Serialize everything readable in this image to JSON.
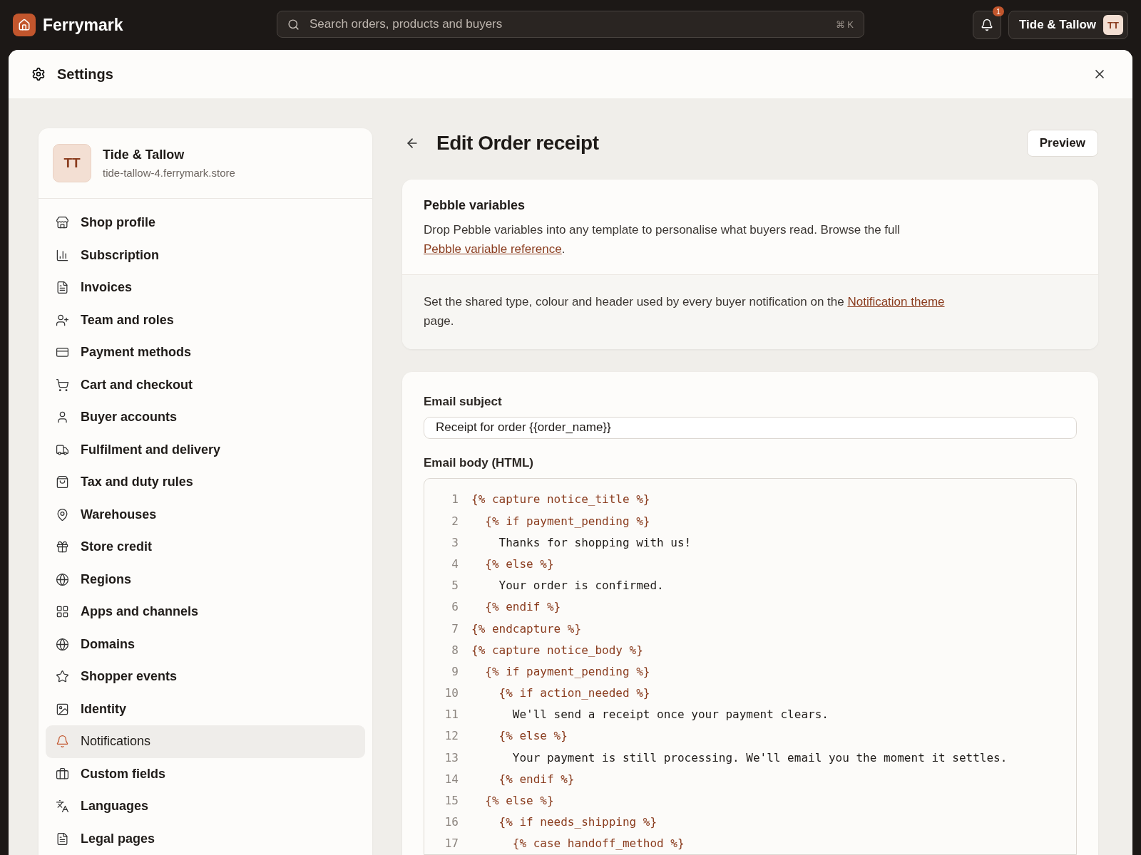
{
  "app": {
    "name": "Ferrymark"
  },
  "search": {
    "placeholder": "Search orders, products and buyers",
    "shortcut": "⌘ K"
  },
  "notifications": {
    "count": "1"
  },
  "account": {
    "name": "Tide & Tallow",
    "initials": "TT"
  },
  "dialog": {
    "title": "Settings"
  },
  "shop": {
    "initials": "TT",
    "name": "Tide & Tallow",
    "domain": "tide-tallow-4.ferrymark.store"
  },
  "sidebar": {
    "items": [
      {
        "label": "Shop profile",
        "selected": false
      },
      {
        "label": "Subscription",
        "selected": false
      },
      {
        "label": "Invoices",
        "selected": false
      },
      {
        "label": "Team and roles",
        "selected": false
      },
      {
        "label": "Payment methods",
        "selected": false
      },
      {
        "label": "Cart and checkout",
        "selected": false
      },
      {
        "label": "Buyer accounts",
        "selected": false
      },
      {
        "label": "Fulfilment and delivery",
        "selected": false
      },
      {
        "label": "Tax and duty rules",
        "selected": false
      },
      {
        "label": "Warehouses",
        "selected": false
      },
      {
        "label": "Store credit",
        "selected": false
      },
      {
        "label": "Regions",
        "selected": false
      },
      {
        "label": "Apps and channels",
        "selected": false
      },
      {
        "label": "Domains",
        "selected": false
      },
      {
        "label": "Shopper events",
        "selected": false
      },
      {
        "label": "Identity",
        "selected": false
      },
      {
        "label": "Notifications",
        "selected": true
      },
      {
        "label": "Custom fields",
        "selected": false
      },
      {
        "label": "Languages",
        "selected": false
      },
      {
        "label": "Legal pages",
        "selected": false
      }
    ]
  },
  "editor": {
    "title": "Edit Order receipt",
    "preview_button": "Preview",
    "info": {
      "title": "Pebble variables",
      "text": "Drop Pebble variables into any template to personalise what buyers read. Browse the full ",
      "link": "Pebble variable reference",
      "text_end": ".",
      "theme_text": "Set the shared type, colour and header used by every buyer notification on the ",
      "theme_link": "Notification theme",
      "theme_text_end": " page."
    },
    "subject": {
      "label": "Email subject",
      "value": "Receipt for order {{order_name}}"
    },
    "body": {
      "label": "Email body (HTML)",
      "lines": [
        {
          "number": "1",
          "kind": "tag",
          "text": "{% capture notice_title %}"
        },
        {
          "number": "2",
          "kind": "tag",
          "text": "  {% if payment_pending %}"
        },
        {
          "number": "3",
          "kind": "text",
          "text": "    Thanks for shopping with us!"
        },
        {
          "number": "4",
          "kind": "tag",
          "text": "  {% else %}"
        },
        {
          "number": "5",
          "kind": "text",
          "text": "    Your order is confirmed."
        },
        {
          "number": "6",
          "kind": "tag",
          "text": "  {% endif %}"
        },
        {
          "number": "7",
          "kind": "tag",
          "text": "{% endcapture %}"
        },
        {
          "number": "8",
          "kind": "tag",
          "text": "{% capture notice_body %}"
        },
        {
          "number": "9",
          "kind": "tag",
          "text": "  {% if payment_pending %}"
        },
        {
          "number": "10",
          "kind": "tag",
          "text": "    {% if action_needed %}"
        },
        {
          "number": "11",
          "kind": "text",
          "text": "      We'll send a receipt once your payment clears."
        },
        {
          "number": "12",
          "kind": "tag",
          "text": "    {% else %}"
        },
        {
          "number": "13",
          "kind": "text",
          "text": "      Your payment is still processing. We'll email you the moment it settles."
        },
        {
          "number": "14",
          "kind": "tag",
          "text": "    {% endif %}"
        },
        {
          "number": "15",
          "kind": "tag",
          "text": "  {% else %}"
        },
        {
          "number": "16",
          "kind": "tag",
          "text": "    {% if needs_shipping %}"
        },
        {
          "number": "17",
          "kind": "tag",
          "text": "      {% case handoff_method %}"
        }
      ]
    }
  }
}
